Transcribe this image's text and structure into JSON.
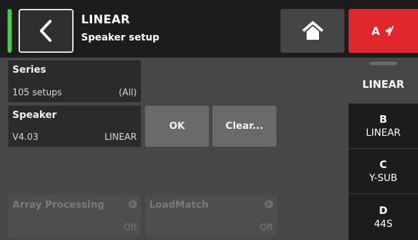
{
  "header": {
    "title": "LINEAR",
    "subtitle": "Speaker setup",
    "mute_label": "A",
    "status_color": "#3fcf3f",
    "mute_color": "#e1262c"
  },
  "main": {
    "series": {
      "title": "Series",
      "count": "105 setups",
      "filter": "(All)"
    },
    "speaker": {
      "title": "Speaker",
      "version": "V4.03",
      "value": "LINEAR"
    },
    "ok_label": "OK",
    "clear_label": "Clear...",
    "array_processing": {
      "title": "Array Processing",
      "value": "Off"
    },
    "loadmatch": {
      "title": "LoadMatch",
      "value": "Off"
    }
  },
  "sidebar": {
    "active": {
      "name": "LINEAR"
    },
    "items": [
      {
        "letter": "B",
        "name": "LINEAR"
      },
      {
        "letter": "C",
        "name": "Y-SUB"
      },
      {
        "letter": "D",
        "name": "44S"
      }
    ]
  },
  "icons": [
    "chevron-left-icon",
    "home-icon",
    "speaker-mute-icon",
    "arrow-right-icon"
  ]
}
